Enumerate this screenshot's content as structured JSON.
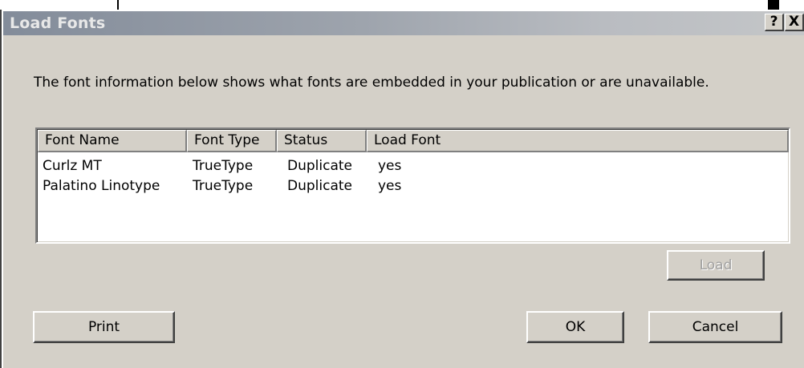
{
  "window": {
    "title": "Load Fonts",
    "help_label": "?",
    "close_label": "X"
  },
  "description": "The font information below shows what fonts are embedded in your publication or are unavailable.",
  "font_list": {
    "columns": [
      "Font Name",
      "Font Type",
      "Status",
      "Load Font"
    ],
    "rows": [
      [
        "Curlz MT",
        "TrueType",
        "Duplicate",
        "yes"
      ],
      [
        "Palatino Linotype",
        "TrueType",
        "Duplicate",
        "yes"
      ]
    ]
  },
  "buttons": {
    "load": "Load",
    "print": "Print",
    "ok": "OK",
    "cancel": "Cancel"
  },
  "colors": {
    "dialog_face": "#d4d0c8",
    "titlebar_start": "#838c9a",
    "titlebar_end": "#c4c6c8",
    "disabled_text": "#a0a0a0"
  }
}
